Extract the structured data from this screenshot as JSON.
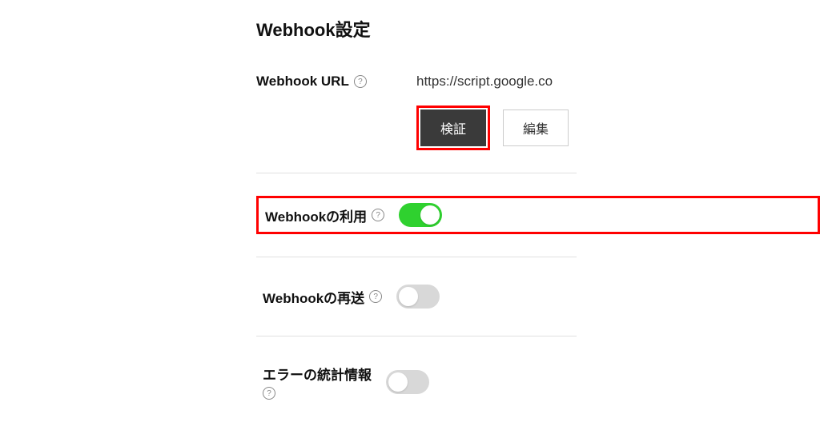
{
  "section": {
    "title": "Webhook設定"
  },
  "webhook_url": {
    "label": "Webhook URL",
    "value": "https://script.google.co",
    "verify_label": "検証",
    "edit_label": "編集"
  },
  "webhook_use": {
    "label": "Webhookの利用",
    "enabled": true
  },
  "webhook_resend": {
    "label": "Webhookの再送",
    "enabled": false
  },
  "error_stats": {
    "label": "エラーの統計情報",
    "enabled": false
  }
}
